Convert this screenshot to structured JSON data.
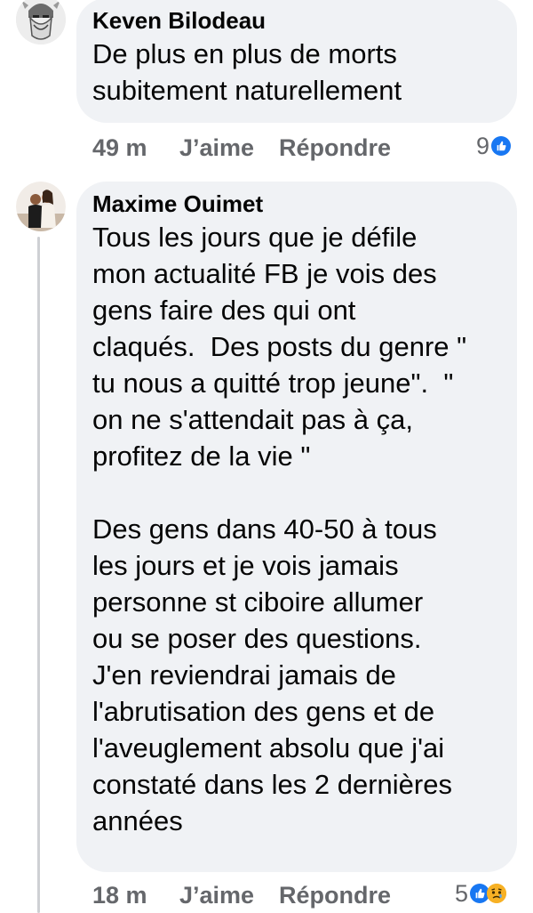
{
  "comments": [
    {
      "author": "Keven Bilodeau",
      "text": "De plus en plus de morts\nsubitement naturellement",
      "time": "49 m",
      "like_label": "J’aime",
      "reply_label": "Répondre",
      "reaction_count": "9",
      "reactions": [
        "like-icon"
      ]
    },
    {
      "author": "Maxime Ouimet",
      "text": "Tous les jours que je défile\nmon actualité FB je vois des\ngens faire des qui ont\nclaqués.  Des posts du genre \"\ntu nous a quitté trop jeune\".  \"\non ne s'attendait pas à ça,\nprofitez de la vie \"\n\nDes gens dans 40-50 à tous\nles jours et je vois jamais\npersonne st ciboire allumer\nou se poser des questions.\nJ'en reviendrai jamais de\nl'abrutisation des gens et de\nl'aveuglement absolu que j'ai\nconstaté dans les 2 dernières\nannées",
      "time": "18 m",
      "like_label": "J’aime",
      "reply_label": "Répondre",
      "reaction_count": "5",
      "reactions": [
        "like-icon",
        "sad-icon"
      ]
    }
  ],
  "colors": {
    "bubble": "#f0f2f5",
    "meta_text": "#65676b",
    "like_blue": "#1877f2",
    "sad_yellow": "#f7b125"
  }
}
